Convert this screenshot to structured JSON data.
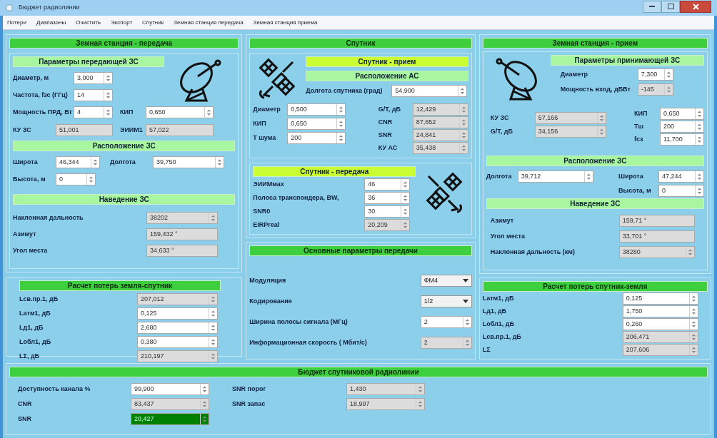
{
  "window": {
    "title": "Бюджет радиолинии"
  },
  "menu": [
    "Потери",
    "Диапазоны",
    "Очистить",
    "Экспорт",
    "Спутник",
    "Земная станция передача",
    "Земная станция приема"
  ],
  "tx_station": {
    "title": {
      "text": "Земная станция - передача",
      "kind": "main"
    },
    "params_title": {
      "text": "Параметры передающей ЗС",
      "kind": "sub"
    },
    "params": [
      {
        "label": "Диаметр, м",
        "value": "3,000",
        "readonly": false,
        "spin": true
      },
      {
        "label": "Частота, fзс (ГГц)",
        "value": "14",
        "readonly": false,
        "spin": true
      },
      {
        "label": "Мощность ПРД, Вт",
        "value": "4",
        "readonly": false,
        "spin": true
      },
      {
        "label": "КИП",
        "value": "0,650",
        "readonly": false,
        "spin": true
      },
      {
        "label": "КУ ЗС",
        "value": "51,001",
        "readonly": true,
        "spin": false
      },
      {
        "label": "ЭИИМ1",
        "value": "57,022",
        "readonly": true,
        "spin": false
      }
    ],
    "location_title": {
      "text": "Расположение ЗС",
      "kind": "sub"
    },
    "location": [
      {
        "label": "Широта",
        "value": "46,344",
        "readonly": false,
        "spin": true
      },
      {
        "label": "Долгота",
        "value": "39,750",
        "readonly": false,
        "spin": true
      },
      {
        "label": "Высота, м",
        "value": "0",
        "readonly": false,
        "spin": true
      }
    ],
    "pointing_title": {
      "text": "Наведение ЗС",
      "kind": "sub"
    },
    "pointing": [
      {
        "label": "Наклонная дальность",
        "value": "38202",
        "readonly": true,
        "spin": true
      },
      {
        "label": "Азимут",
        "value": "159,432 °",
        "readonly": true,
        "spin": false
      },
      {
        "label": "Угол места",
        "value": "34,633 °",
        "readonly": true,
        "spin": false
      }
    ]
  },
  "uplink_losses": {
    "title": {
      "text": "Расчет потерь земля-спутник",
      "kind": "main"
    },
    "fields": [
      {
        "label": "Lсв.пр.1, дБ",
        "value": "207,012",
        "readonly": true,
        "spin": true
      },
      {
        "label": "Lатм1, дБ",
        "value": "0,125",
        "readonly": false,
        "spin": true
      },
      {
        "label": "Lд1, дБ",
        "value": "2,680",
        "readonly": false,
        "spin": true
      },
      {
        "label": "Lобл1, дБ",
        "value": "0,380",
        "readonly": false,
        "spin": true
      },
      {
        "label": "LΣ, дБ",
        "value": "210,197",
        "readonly": true,
        "spin": true
      }
    ]
  },
  "satellite": {
    "title": {
      "text": "Спутник",
      "kind": "main"
    },
    "rx_title": {
      "text": "Спутник - прием",
      "kind": "accent"
    },
    "rx_location_title": {
      "text": "Расположение АС",
      "kind": "sub"
    },
    "longitude": {
      "label": "Долгота спутника (град)",
      "value": "54,900",
      "readonly": false,
      "spin": true
    },
    "rx_left": [
      {
        "label": "Диаметр",
        "value": "0,500",
        "readonly": false,
        "spin": true
      },
      {
        "label": "КИП",
        "value": "0,650",
        "readonly": false,
        "spin": true
      },
      {
        "label": "T шума",
        "value": "200",
        "readonly": false,
        "spin": true
      }
    ],
    "rx_right": [
      {
        "label": "G/T, дБ",
        "value": "12,429",
        "readonly": true,
        "spin": true
      },
      {
        "label": "CNR",
        "value": "87,852",
        "readonly": true,
        "spin": true
      },
      {
        "label": "SNR",
        "value": "24,841",
        "readonly": true,
        "spin": true
      },
      {
        "label": "КУ АС",
        "value": "35,438",
        "readonly": true,
        "spin": true
      }
    ],
    "tx_title": {
      "text": "Спутник - передача",
      "kind": "accent"
    },
    "tx": [
      {
        "label": "ЭИИМмах",
        "value": "46",
        "readonly": false,
        "spin": true
      },
      {
        "label": "Полоса транспондера, BW,",
        "value": "36",
        "readonly": false,
        "spin": true
      },
      {
        "label": "SNR0",
        "value": "30",
        "readonly": false,
        "spin": true
      },
      {
        "label": "EIRPreal",
        "value": "20,209",
        "readonly": true,
        "spin": true
      }
    ]
  },
  "transmission": {
    "title": {
      "text": "Основные параметры передачи",
      "kind": "main"
    },
    "fields": [
      {
        "kind": "select",
        "label": "Модуляция",
        "value": "ФМ4"
      },
      {
        "kind": "select",
        "label": "Кодирование",
        "value": "1/2"
      },
      {
        "kind": "input",
        "label": "Ширина полосы сигнала (МГц)",
        "value": "2",
        "readonly": false,
        "spin": true
      },
      {
        "kind": "input",
        "label": "Информационная скорость ( Мбит/с)",
        "value": "2",
        "readonly": true,
        "spin": true
      }
    ]
  },
  "rx_station": {
    "title": {
      "text": "Земная станция - прием",
      "kind": "main"
    },
    "params_title": {
      "text": "Параметры принимающей ЗС",
      "kind": "sub"
    },
    "top": [
      {
        "label": "Диаметр",
        "value": "7,300",
        "readonly": false,
        "spin": true
      },
      {
        "label": "Мощность вход, дБВт",
        "value": "-145",
        "readonly": true,
        "spin": true
      }
    ],
    "left": [
      {
        "label": "КУ ЗС",
        "value": "57,166",
        "readonly": true,
        "spin": true
      },
      {
        "label": "G/T, дБ",
        "value": "34,156",
        "readonly": true,
        "spin": true
      }
    ],
    "right": [
      {
        "label": "КИП",
        "value": "0,650",
        "readonly": false,
        "spin": true
      },
      {
        "label": "Tш",
        "value": "200",
        "readonly": false,
        "spin": true
      },
      {
        "label": "fсз",
        "value": "11,700",
        "readonly": false,
        "spin": true
      }
    ],
    "location_title": {
      "text": "Расположение ЗС",
      "kind": "sub"
    },
    "location": [
      {
        "label": "Долгота",
        "value": "39,712",
        "readonly": false,
        "spin": true
      },
      {
        "label": "Широта",
        "value": "47,244",
        "readonly": false,
        "spin": true
      },
      {
        "label": "Высота, м",
        "value": "0",
        "readonly": false,
        "spin": true
      }
    ],
    "pointing_title": {
      "text": "Наведение ЗС",
      "kind": "sub"
    },
    "pointing": [
      {
        "label": "Азимут",
        "value": "159,71 °",
        "readonly": true,
        "spin": false
      },
      {
        "label": "Угол места",
        "value": "33,701 °",
        "readonly": true,
        "spin": false
      },
      {
        "label": "Наклонная дальность (км)",
        "value": "38280",
        "readonly": true,
        "spin": true
      }
    ]
  },
  "downlink_losses": {
    "title": {
      "text": "Расчет потерь спутник-земля",
      "kind": "main"
    },
    "fields": [
      {
        "label": "Lатм1, дБ",
        "value": "0,125",
        "readonly": false,
        "spin": true
      },
      {
        "label": "Lд1, дБ",
        "value": "1,750",
        "readonly": false,
        "spin": true
      },
      {
        "label": "Lобл1, дБ",
        "value": "0,260",
        "readonly": false,
        "spin": true
      },
      {
        "label": "Lсв.пр.1, дБ",
        "value": "206,471",
        "readonly": true,
        "spin": true
      },
      {
        "label": "LΣ",
        "value": "207,606",
        "readonly": true,
        "spin": true
      }
    ]
  },
  "budget": {
    "title": {
      "text": "Бюджет спутниковой радиолинии",
      "kind": "main"
    },
    "left": [
      {
        "label": "Доступность канала %",
        "value": "99,900",
        "readonly": false,
        "spin": true
      },
      {
        "label": "CNR",
        "value": "83,437",
        "readonly": true,
        "spin": true
      },
      {
        "label": "SNR",
        "value": "20,427",
        "spin": true,
        "color": "#008000"
      }
    ],
    "right": [
      {
        "label": "SNR порог",
        "value": "1,430",
        "readonly": true,
        "spin": true
      },
      {
        "label": "SNR запас",
        "value": "18,997",
        "readonly": true,
        "spin": true
      }
    ]
  }
}
